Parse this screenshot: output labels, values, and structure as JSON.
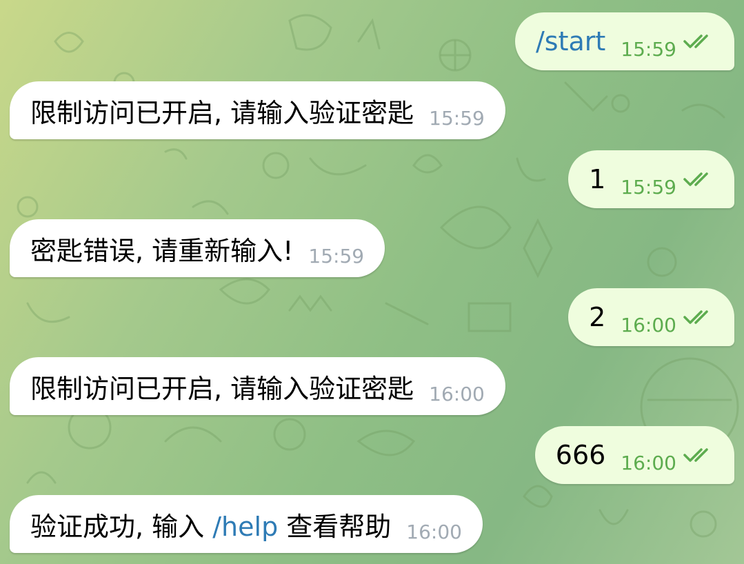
{
  "messages": [
    {
      "dir": "out",
      "text": "/start",
      "time": "15:59",
      "ticks": "double-check-icon"
    },
    {
      "dir": "in",
      "text": "限制访问已开启, 请输入验证密匙",
      "time": "15:59"
    },
    {
      "dir": "out",
      "text": "1",
      "time": "15:59",
      "ticks": "double-check-icon"
    },
    {
      "dir": "in",
      "text": "密匙错误, 请重新输入!",
      "time": "15:59"
    },
    {
      "dir": "out",
      "text": "2",
      "time": "16:00",
      "ticks": "double-check-icon"
    },
    {
      "dir": "in",
      "text": "限制访问已开启, 请输入验证密匙",
      "time": "16:00"
    },
    {
      "dir": "out",
      "text": "666",
      "time": "16:00",
      "ticks": "double-check-icon"
    },
    {
      "dir": "in",
      "text_before": "验证成功, 输入 ",
      "command": "/help",
      "text_after": " 查看帮助",
      "time": "16:00"
    }
  ],
  "colors": {
    "incoming_bubble": "#ffffff",
    "outgoing_bubble": "#effdde",
    "outgoing_meta": "#5dac4f",
    "incoming_meta": "#a1aab3",
    "command_link": "#2e7bb5"
  }
}
